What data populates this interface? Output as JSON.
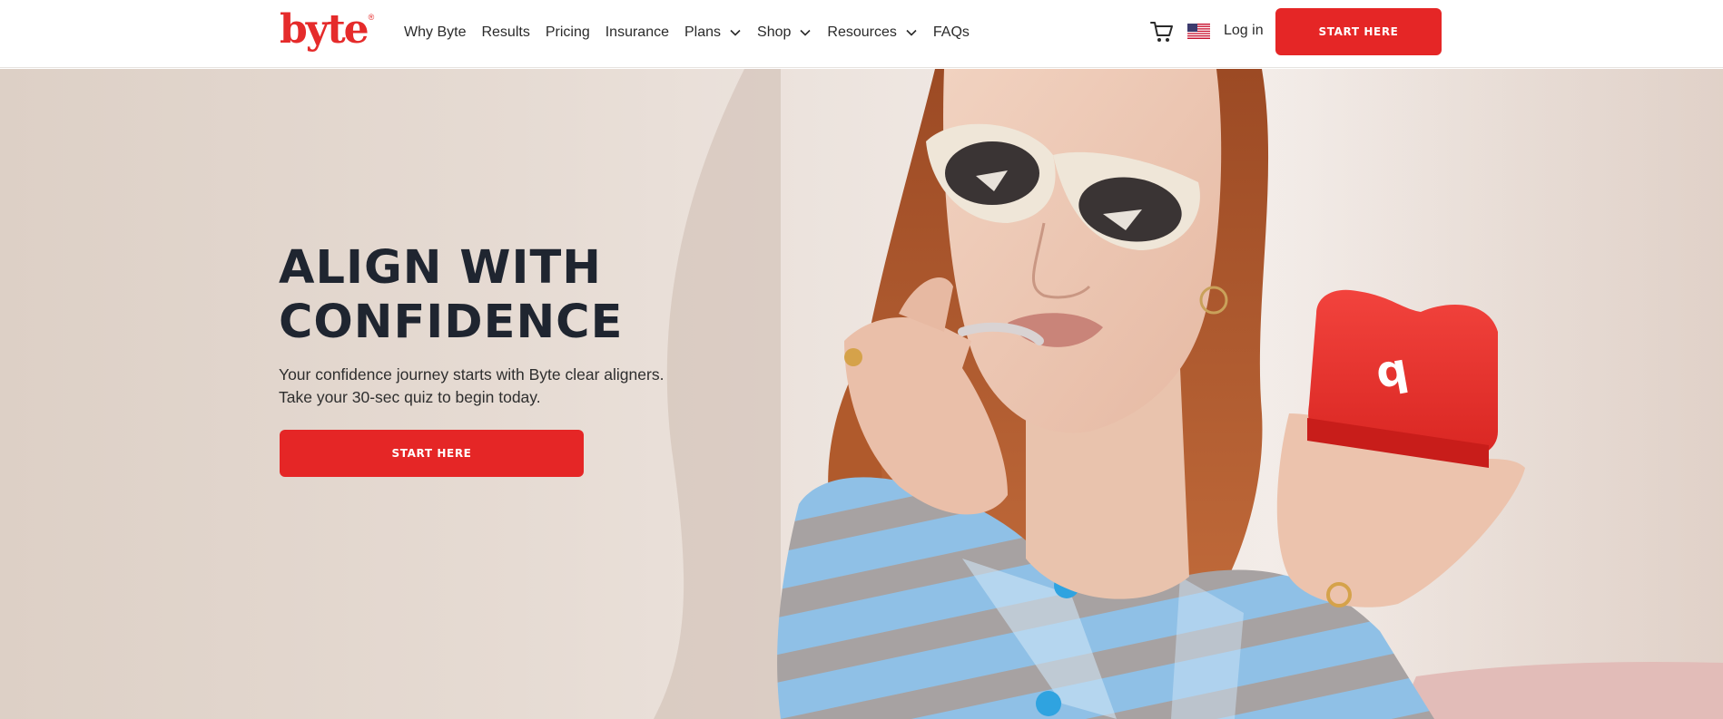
{
  "brand": {
    "logo_text": "byte",
    "logo_mark": "®",
    "primary_color": "#e52626"
  },
  "nav": {
    "items": [
      {
        "label": "Why Byte",
        "has_dropdown": false
      },
      {
        "label": "Results",
        "has_dropdown": false
      },
      {
        "label": "Pricing",
        "has_dropdown": false
      },
      {
        "label": "Insurance",
        "has_dropdown": false
      },
      {
        "label": "Plans",
        "has_dropdown": true
      },
      {
        "label": "Shop",
        "has_dropdown": true
      },
      {
        "label": "Resources",
        "has_dropdown": true
      },
      {
        "label": "FAQs",
        "has_dropdown": false
      }
    ]
  },
  "header": {
    "cart_icon": "cart-icon",
    "flag_icon": "us-flag-icon",
    "login_label": "Log in",
    "cta_label": "START HERE"
  },
  "hero": {
    "title_line1": "ALIGN WITH",
    "title_line2": "CONFIDENCE",
    "subtitle_line1": "Your confidence journey starts with Byte clear aligners.",
    "subtitle_line2": "Take your 30-sec quiz to begin today.",
    "cta_label": "START HERE",
    "case_letter": "b"
  }
}
